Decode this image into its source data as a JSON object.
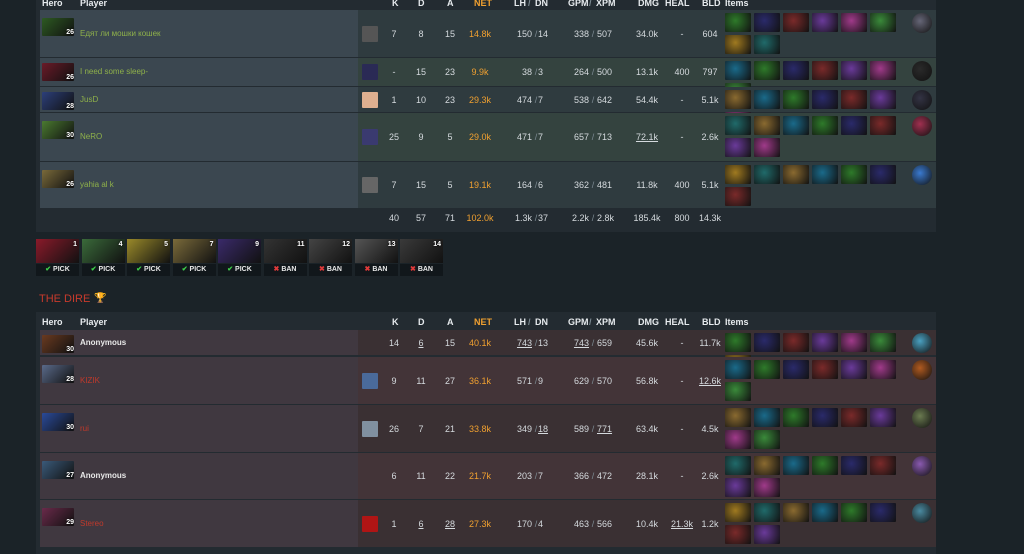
{
  "columns": {
    "hero": "Hero",
    "player": "Player",
    "k": "K",
    "d": "D",
    "a": "A",
    "net": "NET",
    "lh": "LH",
    "dn": "DN",
    "gpm": "GPM",
    "xpm": "XPM",
    "dmg": "DMG",
    "heal": "HEAL",
    "bld": "BLD",
    "items": "Items"
  },
  "sep": "/",
  "radiant": {
    "players": [
      {
        "level": "26",
        "name": "Едят ли мошки кошек",
        "k": "7",
        "d": "8",
        "a": "15",
        "net": "14.8k",
        "lh": "150",
        "dn": "14",
        "gpm": "338",
        "xpm": "507",
        "dmg": "34.0k",
        "heal": "-",
        "bld": "604"
      },
      {
        "level": "26",
        "name": "I need some sleep-",
        "k": "-",
        "d": "15",
        "a": "23",
        "net": "9.9k",
        "lh": "38",
        "dn": "3",
        "gpm": "264",
        "xpm": "500",
        "dmg": "13.1k",
        "heal": "400",
        "bld": "797"
      },
      {
        "level": "28",
        "name": "JusD",
        "k": "1",
        "d": "10",
        "a": "23",
        "net": "29.3k",
        "lh": "474",
        "dn": "7",
        "gpm": "538",
        "xpm": "642",
        "dmg": "54.4k",
        "heal": "-",
        "bld": "5.1k"
      },
      {
        "level": "30",
        "name": "NeRO",
        "k": "25",
        "d": "9",
        "a": "5",
        "net": "29.0k",
        "lh": "471",
        "dn": "7",
        "gpm": "657",
        "xpm": "713",
        "dmg": "72.1k",
        "heal": "-",
        "bld": "2.6k"
      },
      {
        "level": "26",
        "name": "yahia al k",
        "k": "7",
        "d": "15",
        "a": "5",
        "net": "19.1k",
        "lh": "164",
        "dn": "6",
        "gpm": "362",
        "xpm": "481",
        "dmg": "11.8k",
        "heal": "400",
        "bld": "5.1k"
      }
    ],
    "totals": {
      "k": "40",
      "d": "57",
      "a": "71",
      "net": "102.0k",
      "lh": "1.3k",
      "dn": "37",
      "gpm": "2.2k",
      "xpm": "2.8k",
      "dmg": "185.4k",
      "heal": "800",
      "bld": "14.3k"
    }
  },
  "draft": [
    {
      "no": "1",
      "label": "PICK",
      "type": "pick"
    },
    {
      "no": "4",
      "label": "PICK",
      "type": "pick"
    },
    {
      "no": "5",
      "label": "PICK",
      "type": "pick"
    },
    {
      "no": "7",
      "label": "PICK",
      "type": "pick"
    },
    {
      "no": "9",
      "label": "PICK",
      "type": "pick"
    },
    {
      "no": "11",
      "label": "BAN",
      "type": "ban"
    },
    {
      "no": "12",
      "label": "BAN",
      "type": "ban"
    },
    {
      "no": "13",
      "label": "BAN",
      "type": "ban"
    },
    {
      "no": "14",
      "label": "BAN",
      "type": "ban"
    }
  ],
  "dire": {
    "title": "THE DIRE",
    "players": [
      {
        "level": "30",
        "name": "Anonymous",
        "k": "14",
        "d": "6",
        "a": "15",
        "net": "40.1k",
        "lh": "743",
        "dn": "13",
        "gpm": "743",
        "xpm": "659",
        "dmg": "45.6k",
        "heal": "-",
        "bld": "11.7k"
      },
      {
        "level": "28",
        "name": "KIZIK",
        "k": "9",
        "d": "11",
        "a": "27",
        "net": "36.1k",
        "lh": "571",
        "dn": "9",
        "gpm": "629",
        "xpm": "570",
        "dmg": "56.8k",
        "heal": "-",
        "bld": "12.6k"
      },
      {
        "level": "30",
        "name": "rui",
        "k": "26",
        "d": "7",
        "a": "21",
        "net": "33.8k",
        "lh": "349",
        "dn": "18",
        "gpm": "589",
        "xpm": "771",
        "dmg": "63.4k",
        "heal": "-",
        "bld": "4.5k"
      },
      {
        "level": "27",
        "name": "Anonymous",
        "k": "6",
        "d": "11",
        "a": "22",
        "net": "21.7k",
        "lh": "203",
        "dn": "7",
        "gpm": "366",
        "xpm": "472",
        "dmg": "28.1k",
        "heal": "-",
        "bld": "2.6k"
      },
      {
        "level": "29",
        "name": "Stereo",
        "k": "1",
        "d": "6",
        "a": "28",
        "net": "27.3k",
        "lh": "170",
        "dn": "4",
        "gpm": "463",
        "xpm": "566",
        "dmg": "10.4k",
        "heal": "21.3k",
        "bld": "1.2k"
      }
    ]
  },
  "colors": {
    "net": "#f0a030",
    "radiant_name": "#8fb14a",
    "dire_title": "#c83a2c",
    "pick_ok": "#3ecf4a",
    "ban_x": "#e03a3a"
  },
  "icons": {
    "pick": "check-icon",
    "ban": "cross-icon",
    "winner": "trophy-icon"
  }
}
